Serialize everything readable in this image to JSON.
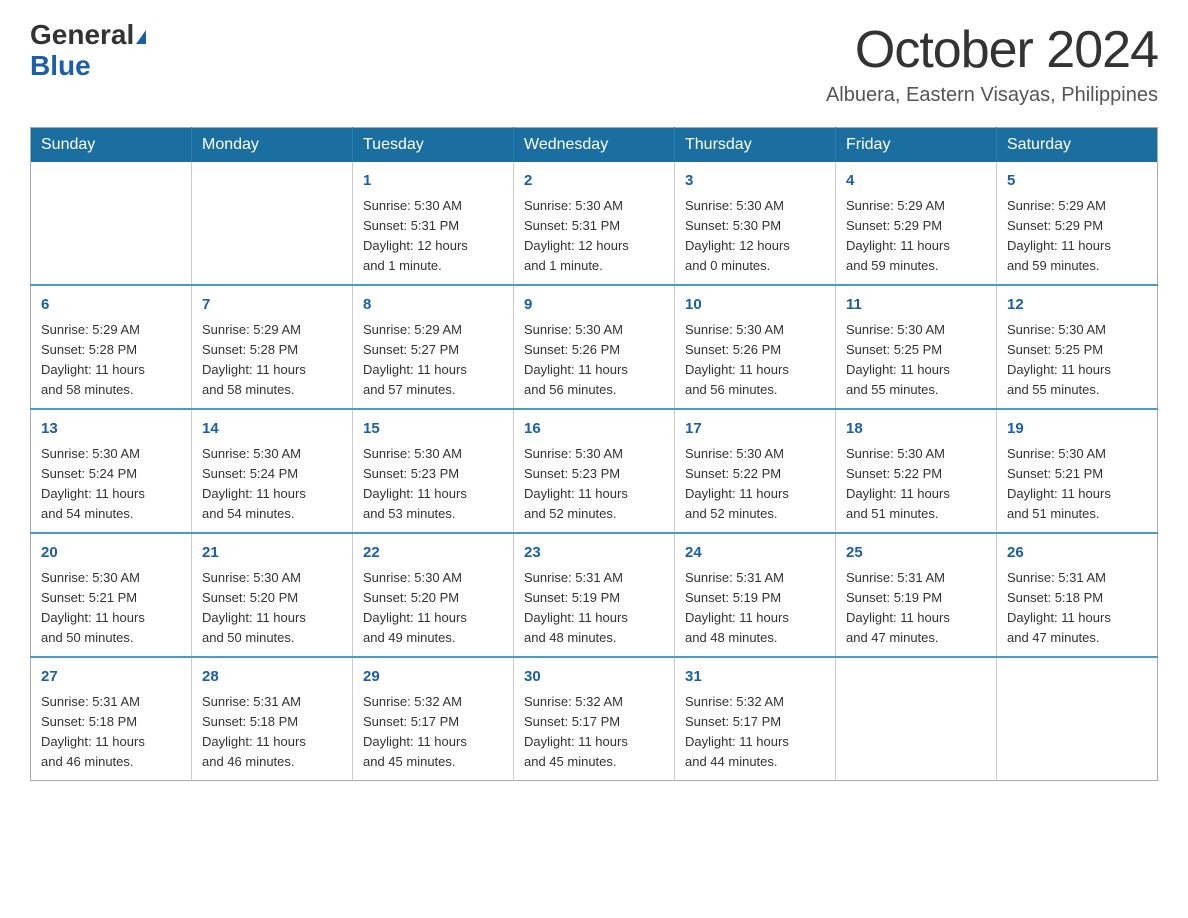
{
  "header": {
    "logo_line1": "General",
    "logo_line2": "Blue",
    "month_title": "October 2024",
    "location": "Albuera, Eastern Visayas, Philippines"
  },
  "weekdays": [
    "Sunday",
    "Monday",
    "Tuesday",
    "Wednesday",
    "Thursday",
    "Friday",
    "Saturday"
  ],
  "weeks": [
    [
      {
        "day": "",
        "info": ""
      },
      {
        "day": "",
        "info": ""
      },
      {
        "day": "1",
        "info": "Sunrise: 5:30 AM\nSunset: 5:31 PM\nDaylight: 12 hours\nand 1 minute."
      },
      {
        "day": "2",
        "info": "Sunrise: 5:30 AM\nSunset: 5:31 PM\nDaylight: 12 hours\nand 1 minute."
      },
      {
        "day": "3",
        "info": "Sunrise: 5:30 AM\nSunset: 5:30 PM\nDaylight: 12 hours\nand 0 minutes."
      },
      {
        "day": "4",
        "info": "Sunrise: 5:29 AM\nSunset: 5:29 PM\nDaylight: 11 hours\nand 59 minutes."
      },
      {
        "day": "5",
        "info": "Sunrise: 5:29 AM\nSunset: 5:29 PM\nDaylight: 11 hours\nand 59 minutes."
      }
    ],
    [
      {
        "day": "6",
        "info": "Sunrise: 5:29 AM\nSunset: 5:28 PM\nDaylight: 11 hours\nand 58 minutes."
      },
      {
        "day": "7",
        "info": "Sunrise: 5:29 AM\nSunset: 5:28 PM\nDaylight: 11 hours\nand 58 minutes."
      },
      {
        "day": "8",
        "info": "Sunrise: 5:29 AM\nSunset: 5:27 PM\nDaylight: 11 hours\nand 57 minutes."
      },
      {
        "day": "9",
        "info": "Sunrise: 5:30 AM\nSunset: 5:26 PM\nDaylight: 11 hours\nand 56 minutes."
      },
      {
        "day": "10",
        "info": "Sunrise: 5:30 AM\nSunset: 5:26 PM\nDaylight: 11 hours\nand 56 minutes."
      },
      {
        "day": "11",
        "info": "Sunrise: 5:30 AM\nSunset: 5:25 PM\nDaylight: 11 hours\nand 55 minutes."
      },
      {
        "day": "12",
        "info": "Sunrise: 5:30 AM\nSunset: 5:25 PM\nDaylight: 11 hours\nand 55 minutes."
      }
    ],
    [
      {
        "day": "13",
        "info": "Sunrise: 5:30 AM\nSunset: 5:24 PM\nDaylight: 11 hours\nand 54 minutes."
      },
      {
        "day": "14",
        "info": "Sunrise: 5:30 AM\nSunset: 5:24 PM\nDaylight: 11 hours\nand 54 minutes."
      },
      {
        "day": "15",
        "info": "Sunrise: 5:30 AM\nSunset: 5:23 PM\nDaylight: 11 hours\nand 53 minutes."
      },
      {
        "day": "16",
        "info": "Sunrise: 5:30 AM\nSunset: 5:23 PM\nDaylight: 11 hours\nand 52 minutes."
      },
      {
        "day": "17",
        "info": "Sunrise: 5:30 AM\nSunset: 5:22 PM\nDaylight: 11 hours\nand 52 minutes."
      },
      {
        "day": "18",
        "info": "Sunrise: 5:30 AM\nSunset: 5:22 PM\nDaylight: 11 hours\nand 51 minutes."
      },
      {
        "day": "19",
        "info": "Sunrise: 5:30 AM\nSunset: 5:21 PM\nDaylight: 11 hours\nand 51 minutes."
      }
    ],
    [
      {
        "day": "20",
        "info": "Sunrise: 5:30 AM\nSunset: 5:21 PM\nDaylight: 11 hours\nand 50 minutes."
      },
      {
        "day": "21",
        "info": "Sunrise: 5:30 AM\nSunset: 5:20 PM\nDaylight: 11 hours\nand 50 minutes."
      },
      {
        "day": "22",
        "info": "Sunrise: 5:30 AM\nSunset: 5:20 PM\nDaylight: 11 hours\nand 49 minutes."
      },
      {
        "day": "23",
        "info": "Sunrise: 5:31 AM\nSunset: 5:19 PM\nDaylight: 11 hours\nand 48 minutes."
      },
      {
        "day": "24",
        "info": "Sunrise: 5:31 AM\nSunset: 5:19 PM\nDaylight: 11 hours\nand 48 minutes."
      },
      {
        "day": "25",
        "info": "Sunrise: 5:31 AM\nSunset: 5:19 PM\nDaylight: 11 hours\nand 47 minutes."
      },
      {
        "day": "26",
        "info": "Sunrise: 5:31 AM\nSunset: 5:18 PM\nDaylight: 11 hours\nand 47 minutes."
      }
    ],
    [
      {
        "day": "27",
        "info": "Sunrise: 5:31 AM\nSunset: 5:18 PM\nDaylight: 11 hours\nand 46 minutes."
      },
      {
        "day": "28",
        "info": "Sunrise: 5:31 AM\nSunset: 5:18 PM\nDaylight: 11 hours\nand 46 minutes."
      },
      {
        "day": "29",
        "info": "Sunrise: 5:32 AM\nSunset: 5:17 PM\nDaylight: 11 hours\nand 45 minutes."
      },
      {
        "day": "30",
        "info": "Sunrise: 5:32 AM\nSunset: 5:17 PM\nDaylight: 11 hours\nand 45 minutes."
      },
      {
        "day": "31",
        "info": "Sunrise: 5:32 AM\nSunset: 5:17 PM\nDaylight: 11 hours\nand 44 minutes."
      },
      {
        "day": "",
        "info": ""
      },
      {
        "day": "",
        "info": ""
      }
    ]
  ]
}
